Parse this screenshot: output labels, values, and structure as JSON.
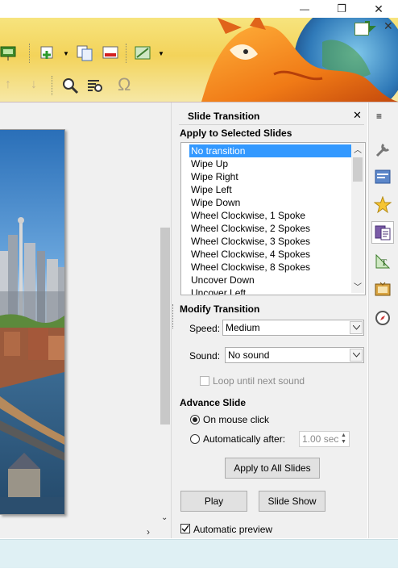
{
  "window": {
    "minimize_glyph": "—",
    "restore_glyph": "❐",
    "close_glyph": "✕"
  },
  "toolbar": {
    "icons": [
      "slide-show-icon",
      "new-slide-icon",
      "duplicate-slide-icon",
      "delete-slide-icon",
      "slide-layout-icon",
      "move-up-icon",
      "move-down-icon",
      "zoom-icon",
      "find-replace-icon",
      "special-character-icon"
    ],
    "omega": "Ω"
  },
  "sidebar_panel": {
    "title": "Slide Transition",
    "close_glyph": "✕",
    "apply_heading": "Apply to Selected Slides",
    "transitions": [
      "No transition",
      "Wipe Up",
      "Wipe Right",
      "Wipe Left",
      "Wipe Down",
      "Wheel Clockwise, 1 Spoke",
      "Wheel Clockwise, 2 Spokes",
      "Wheel Clockwise, 3 Spokes",
      "Wheel Clockwise, 4 Spokes",
      "Wheel Clockwise, 8 Spokes",
      "Uncover Down",
      "Uncover Left"
    ],
    "selected_transition": "No transition",
    "modify_heading": "Modify Transition",
    "speed_label": "Speed:",
    "speed_value": "Medium",
    "sound_label": "Sound:",
    "sound_value": "No sound",
    "loop_label": "Loop until next sound",
    "advance_heading": "Advance Slide",
    "on_click_label": "On mouse click",
    "auto_label": "Automatically after:",
    "auto_value": "1.00 sec",
    "apply_all_button": "Apply to All Slides",
    "play_button": "Play",
    "slideshow_button": "Slide Show",
    "auto_preview_label": "Automatic preview"
  },
  "tabbar": {
    "menu_glyph": "≡",
    "tabs": [
      "properties-icon",
      "slide-design-icon",
      "custom-animation-icon",
      "slide-transition-icon",
      "styles-icon",
      "gallery-icon",
      "navigator-icon"
    ]
  },
  "colors": {
    "selection": "#3399ff",
    "statusbar": "#dff0f4",
    "panel_bg": "#f0f0f0"
  }
}
